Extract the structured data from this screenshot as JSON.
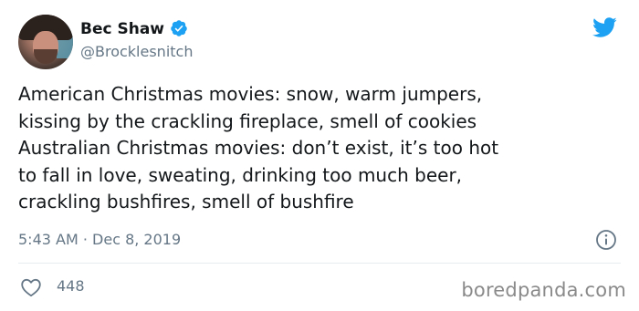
{
  "author": {
    "name": "Bec Shaw",
    "handle": "@Brocklesnitch",
    "verified": true
  },
  "tweet": {
    "text": "American Christmas movies: snow, warm jumpers,\nkissing by the crackling fireplace, smell of cookies\nAustralian Christmas movies: don’t exist, it’s too hot\nto fall in love, sweating, drinking too much beer,\ncrackling bushfires, smell of bushfire",
    "timestamp": "5:43 AM · Dec 8, 2019",
    "likes": "448"
  },
  "watermark": "boredpanda.com",
  "icons": {
    "verified": "verified-badge-icon",
    "brand": "twitter-bird-icon",
    "info": "info-icon",
    "like": "heart-icon"
  },
  "colors": {
    "twitter_blue": "#1da1f2",
    "text": "#14171a",
    "muted": "#657786"
  }
}
